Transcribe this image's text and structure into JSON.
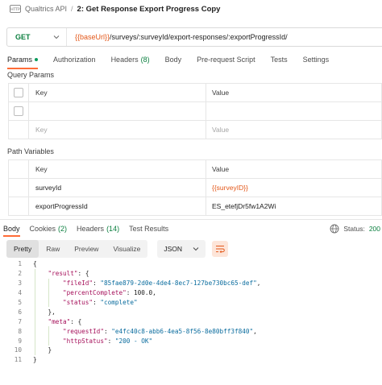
{
  "breadcrumb": {
    "icon": "http-api-icon",
    "parent": "Qualtrics API",
    "separator": "/",
    "current": "2: Get Response Export Progress Copy"
  },
  "request": {
    "method": "GET",
    "url_var": "{{baseUrl}}",
    "url_rest": "/surveys/:surveyId/export-responses/:exportProgressId/"
  },
  "tabs": [
    {
      "label": "Params",
      "active": true,
      "indicator": "green-dot"
    },
    {
      "label": "Authorization"
    },
    {
      "label": "Headers",
      "count": "(8)"
    },
    {
      "label": "Body"
    },
    {
      "label": "Pre-request Script"
    },
    {
      "label": "Tests"
    },
    {
      "label": "Settings"
    }
  ],
  "query_params": {
    "title": "Query Params",
    "headers": [
      "Key",
      "Value"
    ],
    "placeholder": {
      "key": "Key",
      "value": "Value"
    }
  },
  "path_variables": {
    "title": "Path Variables",
    "headers": [
      "Key",
      "Value"
    ],
    "rows": [
      {
        "key": "surveyId",
        "value": "{{surveyID}}"
      },
      {
        "key": "exportProgressId",
        "value": "ES_etefjDr5fw1A2Wi"
      }
    ]
  },
  "response": {
    "tabs": [
      {
        "label": "Body",
        "active": true
      },
      {
        "label": "Cookies",
        "count": "(2)"
      },
      {
        "label": "Headers",
        "count": "(14)"
      },
      {
        "label": "Test Results"
      }
    ],
    "status_label": "Status:",
    "status_value": "200",
    "view_modes": [
      "Pretty",
      "Raw",
      "Preview",
      "Visualize"
    ],
    "active_view": "Pretty",
    "format": "JSON"
  },
  "code_lines": [
    {
      "n": "1",
      "text": "{"
    },
    {
      "n": "2",
      "text": "    \"result\": {"
    },
    {
      "n": "3",
      "text": "        \"fileId\": \"85fae879-2d0e-4de4-8ec7-127be730bc65-def\","
    },
    {
      "n": "4",
      "text": "        \"percentComplete\": 100.0,"
    },
    {
      "n": "5",
      "text": "        \"status\": \"complete\""
    },
    {
      "n": "6",
      "text": "    },"
    },
    {
      "n": "7",
      "text": "    \"meta\": {"
    },
    {
      "n": "8",
      "text": "        \"requestId\": \"e4fc40c8-abb6-4ea5-8f56-8e80bff3f840\","
    },
    {
      "n": "9",
      "text": "        \"httpStatus\": \"200 - OK\""
    },
    {
      "n": "10",
      "text": "    }"
    },
    {
      "n": "11",
      "text": "}"
    }
  ],
  "colors": {
    "accent": "#ff6c37",
    "get_method": "#0b7f3f",
    "variable": "#e3581a",
    "json_key": "#a6115b",
    "json_string": "#0a6c9e"
  }
}
